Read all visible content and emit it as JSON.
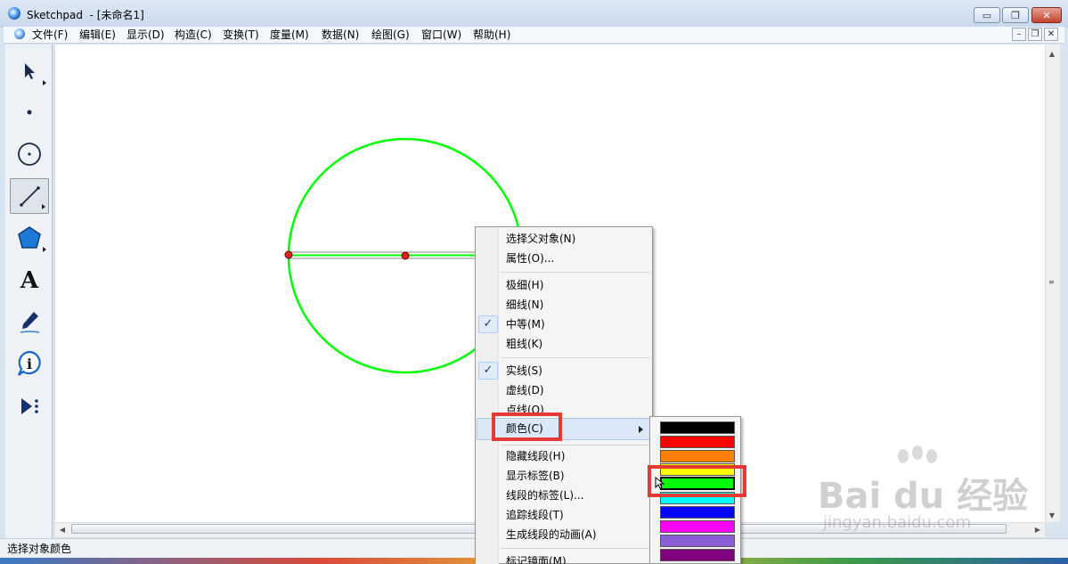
{
  "window": {
    "title": "Sketchpad  - [未命名1]",
    "min_glyph": "▭",
    "restore_glyph": "❐",
    "close_glyph": "✕"
  },
  "menubar": [
    "文件(F)",
    "编辑(E)",
    "显示(D)",
    "构造(C)",
    "变换(T)",
    "度量(M)",
    "数据(N)",
    "绘图(G)",
    "窗口(W)",
    "帮助(H)"
  ],
  "mdi": {
    "min": "–",
    "restore": "❐",
    "close": "✕"
  },
  "toolbox": [
    {
      "name": "select-arrow-tool",
      "icon": "arrow-icon"
    },
    {
      "name": "point-tool",
      "icon": "point-icon"
    },
    {
      "name": "compass-tool",
      "icon": "circle-icon"
    },
    {
      "name": "straightedge-tool",
      "icon": "segment-icon",
      "selected": true
    },
    {
      "name": "polygon-tool",
      "icon": "polygon-icon"
    },
    {
      "name": "text-tool",
      "icon": "text-a-icon",
      "glyph": "A"
    },
    {
      "name": "marker-tool",
      "icon": "marker-pen-icon"
    },
    {
      "name": "information-tool",
      "icon": "info-icon",
      "glyph": "i"
    },
    {
      "name": "custom-tool",
      "icon": "play-custom-icon"
    }
  ],
  "context_menu": {
    "group1": [
      "选择父对象(N)",
      "属性(O)..."
    ],
    "group2": [
      {
        "label": "极细(H)",
        "checked": false
      },
      {
        "label": "细线(N)",
        "checked": false
      },
      {
        "label": "中等(M)",
        "checked": true
      },
      {
        "label": "粗线(K)",
        "checked": false
      }
    ],
    "group3": [
      {
        "label": "实线(S)",
        "checked": true
      },
      {
        "label": "虚线(D)",
        "checked": false
      },
      {
        "label": "点线(O)",
        "checked": false
      }
    ],
    "color_item": "颜色(C)",
    "group4": [
      "隐藏线段(H)",
      "显示标签(B)",
      "线段的标签(L)...",
      "追踪线段(T)",
      "生成线段的动画(A)"
    ],
    "group5": [
      "标记镜面(M)"
    ],
    "check_glyph": "✓"
  },
  "color_submenu": [
    "#000000",
    "#ff0000",
    "#ff7f00",
    "#ffff00",
    "#00ff00",
    "#00ffff",
    "#0000ff",
    "#ff00ff",
    "#8a5cd6",
    "#7f007f"
  ],
  "selected_color": "#00ff00",
  "figure": {
    "circle_color": "#00ff00",
    "point_color": "#e0201c"
  },
  "statusbar": {
    "text": "选择对象颜色"
  },
  "watermark": {
    "brand": "Bai du 经验",
    "url": "jingyan.baidu.com"
  },
  "colors": {
    "highlight_box": "#e53935",
    "titlebar": "#dfe9f5"
  }
}
